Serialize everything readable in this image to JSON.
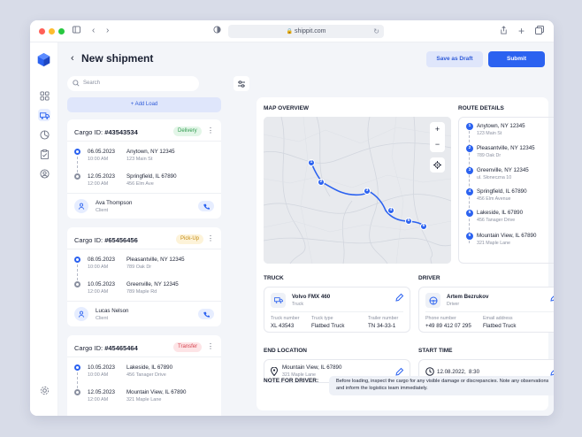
{
  "browser": {
    "url": "shippit.com"
  },
  "header": {
    "title": "New shipment",
    "save_draft": "Save as Draft",
    "submit": "Submit"
  },
  "colors": {
    "accent": "#2b62f0",
    "delivery_bg": "#e3f6e8",
    "delivery_fg": "#2f9a4e",
    "pickup_bg": "#fdf3d9",
    "pickup_fg": "#c48a12",
    "transfer_bg": "#fde4e6",
    "transfer_fg": "#d64550"
  },
  "sidebar_icons": [
    "layout-icon",
    "truck-icon",
    "chart-icon",
    "clipboard-icon",
    "user-icon",
    "settings-icon"
  ],
  "search": {
    "placeholder": "Search"
  },
  "add_load": "+ Add Load",
  "cargo": [
    {
      "label": "Cargo ID:",
      "id": "#43543534",
      "status": "Delivery",
      "from": {
        "date": "06.05.2023",
        "time": "10:00 AM",
        "city": "Anytown, NY 12345",
        "addr": "123 Main St"
      },
      "to": {
        "date": "12.05.2023",
        "time": "12:00 AM",
        "city": "Springfield, IL 67890",
        "addr": "456 Elm Ave"
      },
      "client": {
        "name": "Ava Thompson",
        "role": "Client"
      }
    },
    {
      "label": "Cargo ID:",
      "id": "#65456456",
      "status": "Pick-Up",
      "from": {
        "date": "08.05.2023",
        "time": "10:00 AM",
        "city": "Pleasantville, NY 12345",
        "addr": "789 Oak Dr"
      },
      "to": {
        "date": "10.05.2023",
        "time": "12:00 AM",
        "city": "Greenville, NY 12345",
        "addr": "789 Maple Rd"
      },
      "client": {
        "name": "Lucas Nelson",
        "role": "Client"
      }
    },
    {
      "label": "Cargo ID:",
      "id": "#45465464",
      "status": "Transfer",
      "from": {
        "date": "10.05.2023",
        "time": "10:00 AM",
        "city": "Lakeside, IL 67890",
        "addr": "456 Tanager Drive"
      },
      "to": {
        "date": "12.05.2023",
        "time": "12:00 AM",
        "city": "Mountain View, IL 67890",
        "addr": "321 Maple Lane"
      }
    }
  ],
  "map": {
    "title": "MAP OVERVIEW",
    "zoom_in": "+",
    "zoom_out": "−",
    "pins": [
      "1",
      "2",
      "3",
      "4",
      "5",
      "6"
    ]
  },
  "route": {
    "title": "ROUTE DETAILS",
    "steps": [
      {
        "n": "1",
        "city": "Anytown, NY 12345",
        "addr": "123 Main St"
      },
      {
        "n": "2",
        "city": "Pleasantville, NY 12345",
        "addr": "789 Oak Dr"
      },
      {
        "n": "3",
        "city": "Greenville, NY 12345",
        "addr": "ul. Słoneczna 10"
      },
      {
        "n": "4",
        "city": "Springfield, IL 67890",
        "addr": "456 Elm Avenue"
      },
      {
        "n": "5",
        "city": "Lakeside, IL 67890",
        "addr": "456 Tanager Drive"
      },
      {
        "n": "6",
        "city": "Mountain View, IL 67890",
        "addr": "321 Maple Lane"
      }
    ]
  },
  "truck": {
    "title": "TRUCK",
    "name": "Volvo FMX 460",
    "sub": "Truck",
    "fields": [
      {
        "label": "Truck number",
        "value": "XL 43543"
      },
      {
        "label": "Truck type",
        "value": "Flatbed Truck"
      },
      {
        "label": "Trailer number",
        "value": "TN 34-33-1"
      }
    ]
  },
  "driver": {
    "title": "DRIVER",
    "name": "Artem Bezrukov",
    "sub": "Driver",
    "fields": [
      {
        "label": "Phone number",
        "value": "+49 89 412 07 295"
      },
      {
        "label": "Email address",
        "value": "Flatbed Truck"
      }
    ]
  },
  "end_location": {
    "title": "END LOCATION",
    "city": "Mountain View, IL 67890",
    "addr": "321 Maple Lane"
  },
  "start_time": {
    "title": "START TIME",
    "date": "12.08.2022,",
    "time": "8:30"
  },
  "note": {
    "title": "NOTE FOR DRIVER:",
    "text": "Before loading, inspect the cargo for any visible damage or discrepancies. Note any observations and inform the logistics team immediately."
  }
}
